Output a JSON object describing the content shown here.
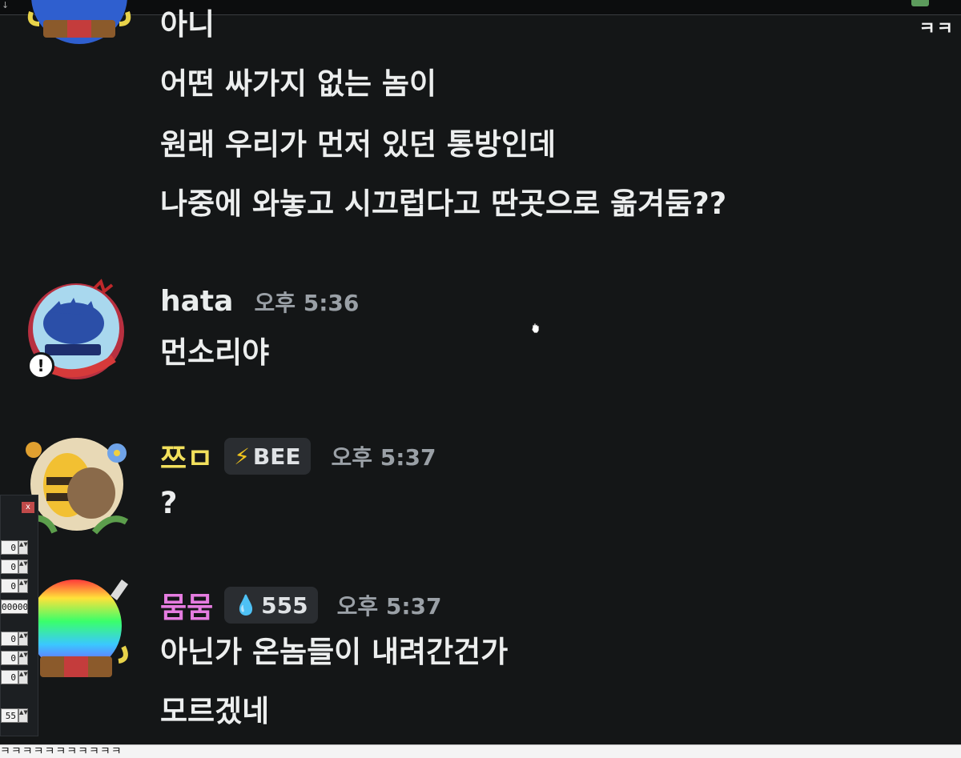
{
  "topbar": {
    "mark": "↓"
  },
  "corner_text": "ㅋㅋ",
  "messages": {
    "m1": {
      "lines": [
        "아니",
        "어떤 싸가지 없는 놈이",
        "원래 우리가 먼저 있던 통방인데",
        "나중에 와놓고 시끄럽다고 딴곳으로 옮겨둠??"
      ]
    },
    "m2": {
      "username": "hata",
      "username_color": "#e9ecec",
      "timestamp": "오후 5:36",
      "lines": [
        "먼소리야"
      ],
      "avatar_badge": "!"
    },
    "m3": {
      "username": "쯔ㅁ",
      "username_color": "#f2e05c",
      "badge": {
        "icon": "⚡",
        "label": "BEE"
      },
      "timestamp": "오후 5:37",
      "lines": [
        "?"
      ]
    },
    "m4": {
      "username": "뭄뭄",
      "username_color": "#e57ce0",
      "badge": {
        "icon": "💧",
        "label": "555"
      },
      "timestamp": "오후 5:37",
      "lines": [
        "아닌가 온놈들이 내려간건가",
        "모르겠네"
      ]
    }
  },
  "side_panel": {
    "close": "x",
    "values": [
      "0",
      "0",
      "0",
      "00000",
      "0",
      "0",
      "0",
      "55"
    ]
  },
  "bottom_strip": {
    "text": "ㅋㅋㅋㅋㅋㅋㅋㅋㅋㅋㅋ"
  }
}
